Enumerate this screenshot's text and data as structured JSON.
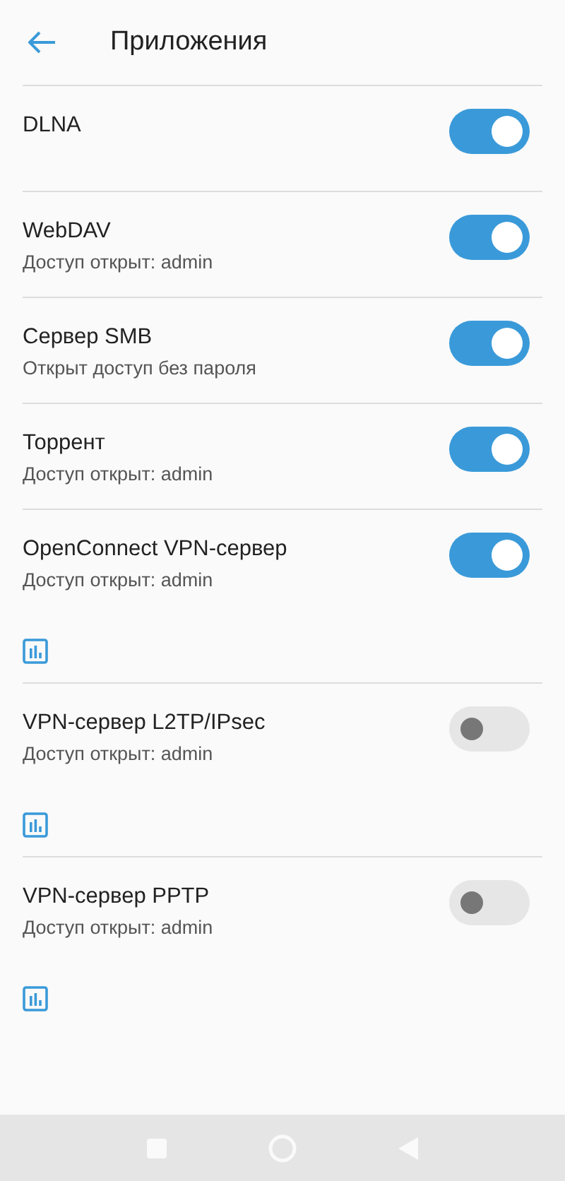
{
  "header": {
    "title": "Приложения"
  },
  "apps": [
    {
      "name": "DLNA",
      "on": true,
      "stats": false
    },
    {
      "name": "WebDAV",
      "subtitle": "Доступ открыт: admin",
      "on": true,
      "stats": false
    },
    {
      "name": "Сервер SMB",
      "subtitle": "Открыт доступ без пароля",
      "on": true,
      "stats": false
    },
    {
      "name": "Торрент",
      "subtitle": "Доступ открыт: admin",
      "on": true,
      "stats": false
    },
    {
      "name": "OpenConnect VPN-сервер",
      "subtitle": "Доступ открыт: admin",
      "on": true,
      "stats": true
    },
    {
      "name": "VPN-сервер L2TP/IPsec",
      "subtitle": "Доступ открыт: admin",
      "on": false,
      "stats": true
    },
    {
      "name": "VPN-сервер PPTP",
      "subtitle": "Доступ открыт: admin",
      "on": false,
      "stats": true
    }
  ]
}
